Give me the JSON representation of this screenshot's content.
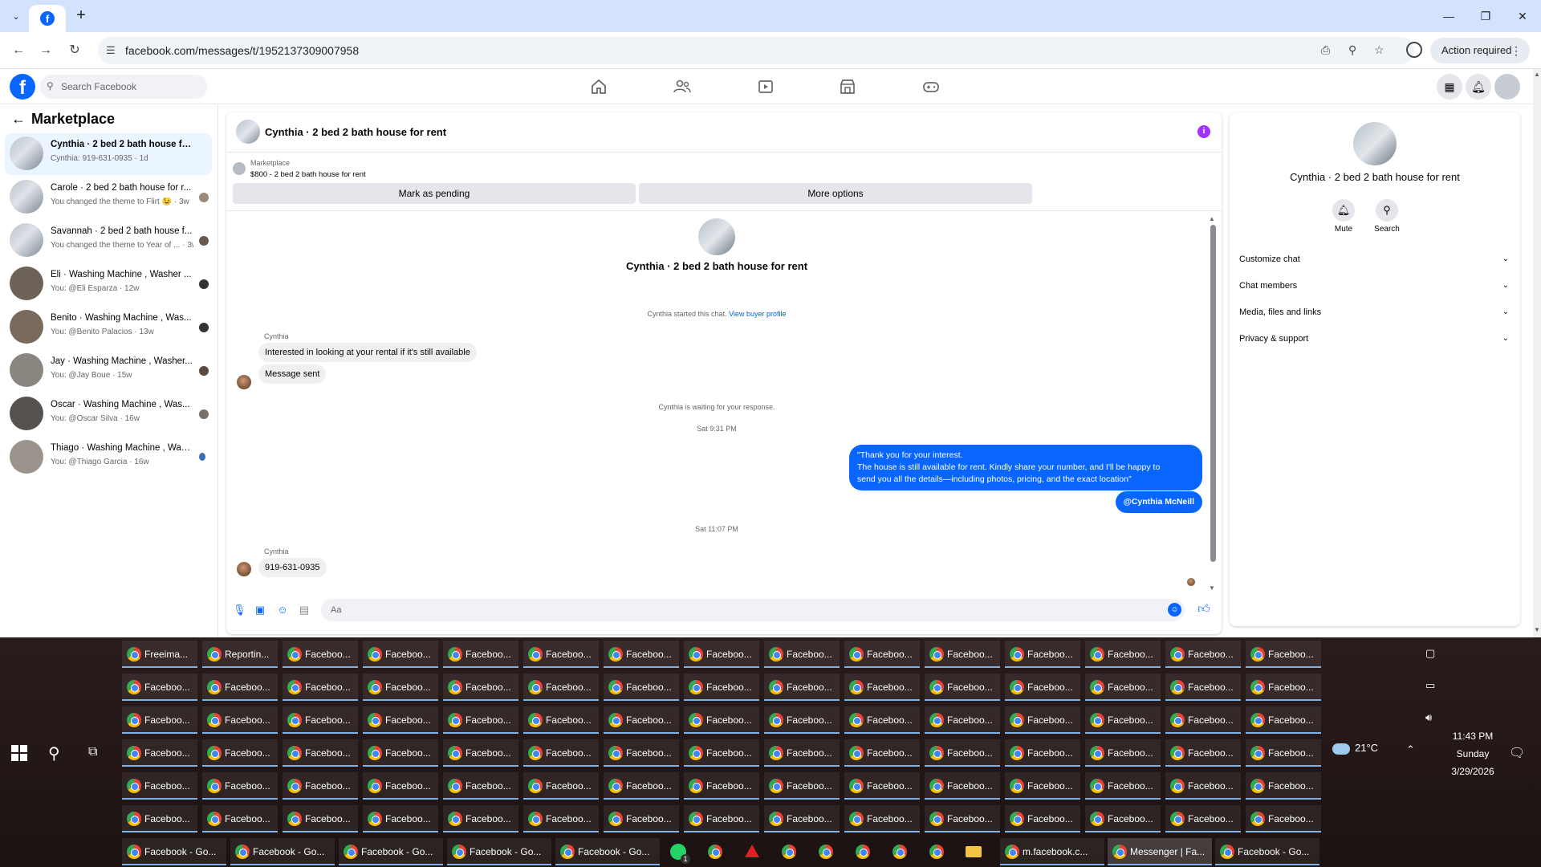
{
  "browser": {
    "url": "facebook.com/messages/t/1952137309007958",
    "action_required": "Action required"
  },
  "facebook": {
    "search_placeholder": "Search Facebook"
  },
  "sidebar": {
    "title": "Marketplace",
    "conversations": [
      {
        "name": "Cynthia · 2 bed 2 bath house for re...",
        "preview": "Cynthia: 919-631-0935 · 1d"
      },
      {
        "name": "Carole · 2 bed 2 bath house for r...",
        "preview": "You changed the theme to Flirt 😉 · 3w"
      },
      {
        "name": "Savannah · 2 bed 2 bath house f...",
        "preview": "You changed the theme to Year of ... · 3w"
      },
      {
        "name": "Eli · Washing Machine , Washer ...",
        "preview": "You: @Eli Esparza · 12w"
      },
      {
        "name": "Benito · Washing Machine , Was...",
        "preview": "You: @Benito Palacios · 13w"
      },
      {
        "name": "Jay · Washing Machine , Washer...",
        "preview": "You: @Jay Boue · 15w"
      },
      {
        "name": "Oscar · Washing Machine , Was...",
        "preview": "You: @Oscar Silva · 16w"
      },
      {
        "name": "Thiago · Washing Machine , Was...",
        "preview": "You: @Thiago Garcia · 16w"
      }
    ]
  },
  "chat": {
    "title": "Cynthia · 2 bed 2 bath house for rent",
    "listing_source": "Marketplace",
    "listing": "$800 - 2 bed 2 bath house for rent",
    "mark_pending": "Mark as pending",
    "more_options": "More options",
    "center_name": "Cynthia · 2 bed 2 bath house for rent",
    "started": "Cynthia started this chat.",
    "view_profile": "View buyer profile",
    "sender1": "Cynthia",
    "msg1": "Interested in looking at your rental if it's still available",
    "msg2": "Message sent",
    "waiting": "Cynthia is waiting for your response.",
    "time1": "Sat 9:31 PM",
    "out_line1": "\"Thank you for your interest.",
    "out_line2": "The house is still available for rent. Kindly share your number, and I'll be happy to",
    "out_line3": "send you all the details—including photos, pricing, and the exact location\"",
    "out_tag": "@Cynthia McNeill",
    "time2": "Sat 11:07 PM",
    "sender2": "Cynthia",
    "msg3": "919-631-0935",
    "composer_placeholder": "Aa"
  },
  "details": {
    "name": "Cynthia · 2 bed 2 bath house for rent",
    "mute": "Mute",
    "search": "Search",
    "rows": [
      "Customize chat",
      "Chat members",
      "Media, files and links",
      "Privacy & support"
    ]
  },
  "taskbar": {
    "rows": [
      [
        "Freeima...",
        "Reportin...",
        "Faceboo...",
        "Faceboo...",
        "Faceboo...",
        "Faceboo...",
        "Faceboo...",
        "Faceboo...",
        "Faceboo...",
        "Faceboo...",
        "Faceboo...",
        "Faceboo...",
        "Faceboo...",
        "Faceboo...",
        "Faceboo..."
      ],
      [
        "Faceboo...",
        "Faceboo...",
        "Faceboo...",
        "Faceboo...",
        "Faceboo...",
        "Faceboo...",
        "Faceboo...",
        "Faceboo...",
        "Faceboo...",
        "Faceboo...",
        "Faceboo...",
        "Faceboo...",
        "Faceboo...",
        "Faceboo...",
        "Faceboo..."
      ],
      [
        "Faceboo...",
        "Faceboo...",
        "Faceboo...",
        "Faceboo...",
        "Faceboo...",
        "Faceboo...",
        "Faceboo...",
        "Faceboo...",
        "Faceboo...",
        "Faceboo...",
        "Faceboo...",
        "Faceboo...",
        "Faceboo...",
        "Faceboo...",
        "Faceboo..."
      ],
      [
        "Faceboo...",
        "Faceboo...",
        "Faceboo...",
        "Faceboo...",
        "Faceboo...",
        "Faceboo...",
        "Faceboo...",
        "Faceboo...",
        "Faceboo...",
        "Faceboo...",
        "Faceboo...",
        "Faceboo...",
        "Faceboo...",
        "Faceboo...",
        "Faceboo..."
      ],
      [
        "Faceboo...",
        "Faceboo...",
        "Faceboo...",
        "Faceboo...",
        "Faceboo...",
        "Faceboo...",
        "Faceboo...",
        "Faceboo...",
        "Faceboo...",
        "Faceboo...",
        "Faceboo...",
        "Faceboo...",
        "Faceboo...",
        "Faceboo...",
        "Faceboo..."
      ],
      [
        "Faceboo...",
        "Faceboo...",
        "Faceboo...",
        "Faceboo...",
        "Faceboo...",
        "Faceboo...",
        "Faceboo...",
        "Faceboo...",
        "Faceboo...",
        "Faceboo...",
        "Faceboo...",
        "Faceboo...",
        "Faceboo...",
        "Faceboo...",
        "Faceboo..."
      ]
    ],
    "bottom_a": [
      "Facebook - Go...",
      "Facebook - Go...",
      "Facebook - Go...",
      "Facebook - Go...",
      "Facebook - Go..."
    ],
    "bottom_b": [
      "m.facebook.c...",
      "Messenger | Fa...",
      "Facebook - Go..."
    ],
    "whatsapp_badge": "1",
    "temperature": "21°C",
    "time": "11:43 PM",
    "day": "Sunday",
    "date": "3/29/2026"
  },
  "colors": {
    "fb_blue": "#0866ff",
    "bubble_out": "#0866ff",
    "info_purple": "#a033ff"
  }
}
